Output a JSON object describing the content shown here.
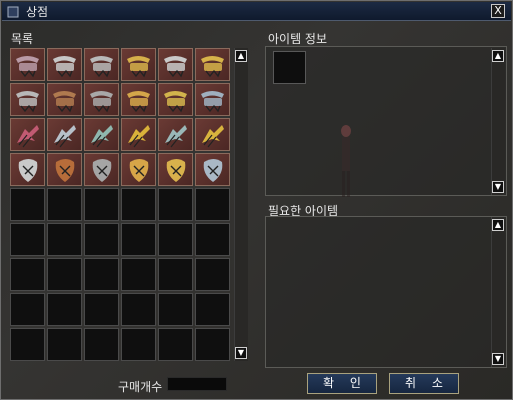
{
  "window": {
    "title": "상점",
    "close_symbol": "X"
  },
  "list": {
    "label": "목록"
  },
  "item_info": {
    "label": "아이템 정보"
  },
  "required_items": {
    "label": "필요한 아이템"
  },
  "quantity": {
    "label": "구매개수",
    "value": ""
  },
  "buttons": {
    "confirm": "확 인",
    "cancel": "취 소"
  },
  "scroll": {
    "up": "▲",
    "down": "▼"
  },
  "inventory": {
    "columns": 6,
    "rows": 9,
    "items": [
      {
        "icon": "crossbow-icon",
        "color": "#b99aa6"
      },
      {
        "icon": "crossbow-icon",
        "color": "#c7c7c7"
      },
      {
        "icon": "crossbow-icon",
        "color": "#b9b9b9"
      },
      {
        "icon": "crossbow-icon",
        "color": "#d6b04a"
      },
      {
        "icon": "crossbow-icon",
        "color": "#c9c9c9"
      },
      {
        "icon": "crossbow-icon",
        "color": "#d7b34a"
      },
      {
        "icon": "crossbow-icon",
        "color": "#b8b8b8"
      },
      {
        "icon": "crossbow-icon",
        "color": "#b07a4f"
      },
      {
        "icon": "crossbow-icon",
        "color": "#a8a8a8"
      },
      {
        "icon": "crossbow-icon",
        "color": "#d4a64a"
      },
      {
        "icon": "crossbow-icon",
        "color": "#d2b44c"
      },
      {
        "icon": "crossbow-icon",
        "color": "#9fb0bf"
      },
      {
        "icon": "claw-icon",
        "color": "#c15a72"
      },
      {
        "icon": "claw-icon",
        "color": "#b7c0c9"
      },
      {
        "icon": "claw-icon",
        "color": "#8fb7ae"
      },
      {
        "icon": "claw-icon",
        "color": "#d9b13a"
      },
      {
        "icon": "claw-icon",
        "color": "#9ab7b7"
      },
      {
        "icon": "claw-icon",
        "color": "#d8b43e"
      },
      {
        "icon": "shield-claw-icon",
        "color": "#c9c9c9"
      },
      {
        "icon": "shield-claw-icon",
        "color": "#b76d3a"
      },
      {
        "icon": "shield-claw-icon",
        "color": "#a5a5a5"
      },
      {
        "icon": "shield-claw-icon",
        "color": "#d7a548"
      },
      {
        "icon": "shield-claw-icon",
        "color": "#d8b14c"
      },
      {
        "icon": "shield-claw-icon",
        "color": "#a9b8c6"
      }
    ]
  }
}
